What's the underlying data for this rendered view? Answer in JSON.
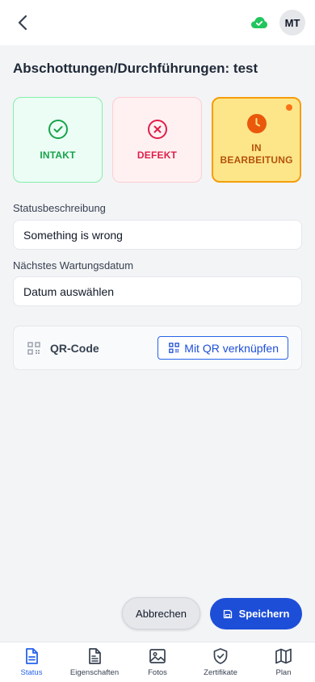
{
  "header": {
    "avatar_initials": "MT",
    "sync_status_color": "#22c55e"
  },
  "page": {
    "title": "Abschottungen/Durchführungen: test"
  },
  "status_options": [
    {
      "label": "INTAKT",
      "icon": "check-circle-icon",
      "color": "#16a34a"
    },
    {
      "label": "DEFEKT",
      "icon": "x-circle-icon",
      "color": "#e11d48"
    },
    {
      "label": "IN BEARBEITUNG",
      "icon": "clock-icon",
      "color": "#b45309",
      "selected": true
    }
  ],
  "form": {
    "status_description_label": "Statusbeschreibung",
    "status_description_value": "Something is wrong",
    "next_maintenance_label": "Nächstes Wartungsdatum",
    "next_maintenance_placeholder": "Datum auswählen"
  },
  "qr": {
    "title": "QR-Code",
    "link_button": "Mit QR verknüpfen"
  },
  "actions": {
    "cancel": "Abbrechen",
    "save": "Speichern"
  },
  "nav": {
    "items": [
      {
        "label": "Status",
        "icon": "document-icon",
        "active": true
      },
      {
        "label": "Eigenschaften",
        "icon": "file-text-icon"
      },
      {
        "label": "Fotos",
        "icon": "image-icon"
      },
      {
        "label": "Zertifikate",
        "icon": "shield-check-icon"
      },
      {
        "label": "Plan",
        "icon": "map-icon"
      }
    ]
  },
  "colors": {
    "primary": "#1d4ed8",
    "in_progress_bg": "#fde68a",
    "in_progress_border": "#f59e0b"
  }
}
